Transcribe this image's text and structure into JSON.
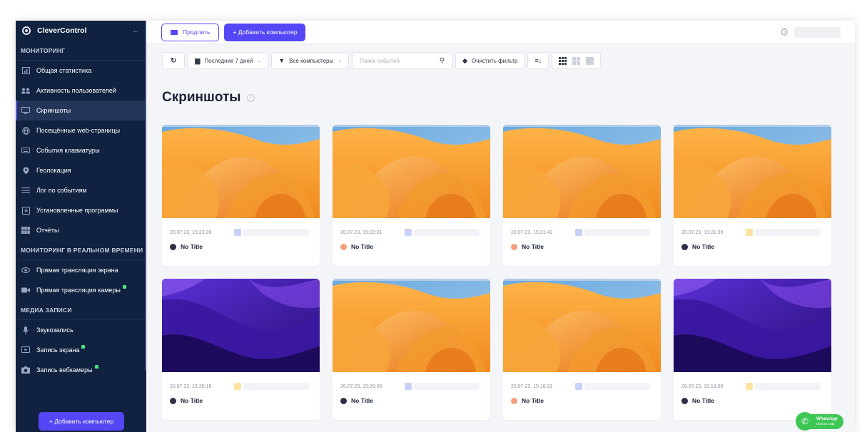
{
  "sidebar": {
    "brand": "CleverControl",
    "section_monitoring": "МОНИТОРИНГ",
    "monitoring_items": [
      {
        "label": "Общая статистика",
        "icon": "stats-icon"
      },
      {
        "label": "Активность пользователей",
        "icon": "users-icon"
      },
      {
        "label": "Скриншоты",
        "icon": "monitor-icon"
      },
      {
        "label": "Посещённые web-страницы",
        "icon": "globe-icon"
      },
      {
        "label": "События клавиатуры",
        "icon": "keyboard-icon"
      },
      {
        "label": "Геолокация",
        "icon": "pin-icon"
      },
      {
        "label": "Лог по событиям",
        "icon": "list-icon"
      },
      {
        "label": "Установленные программы",
        "icon": "install-icon"
      },
      {
        "label": "Отчёты",
        "icon": "reports-icon"
      }
    ],
    "section_realtime": "МОНИТОРИНГ В РЕАЛЬНОМ ВРЕМЕНИ",
    "realtime_items": [
      {
        "label": "Прямая трансляция экрана",
        "icon": "eye-icon"
      },
      {
        "label": "Прямая трансляция камеры",
        "icon": "camera-icon"
      }
    ],
    "section_media": "МЕДИА ЗАПИСИ",
    "media_items": [
      {
        "label": "Звукозапись",
        "icon": "microphone-icon"
      },
      {
        "label": "Запись экрана",
        "icon": "screen-record-icon"
      },
      {
        "label": "Запись вебкамеры",
        "icon": "webcam-icon"
      }
    ],
    "add_button": "+ Добавить компьютер"
  },
  "topbar": {
    "extend_label": "Продлить",
    "add_computer_label": "+ Добавить компьютер"
  },
  "filters": {
    "period": "Последние 7 дней",
    "computers": "Все компьютеры",
    "search_placeholder": "Поиск событий",
    "clear": "Очистить фильтр"
  },
  "page": {
    "title": "Скриншоты"
  },
  "screenshots": [
    {
      "date": "20.07.23, 15:23:26",
      "title": "No Title",
      "dot": "#2c3047",
      "tag": "#c9d1fb",
      "wallpaper": "orange"
    },
    {
      "date": "20.07.23, 15:22:01",
      "title": "No Title",
      "dot": "#f5a07c",
      "tag": "#c9d1fb",
      "wallpaper": "orange"
    },
    {
      "date": "20.07.23, 15:21:42",
      "title": "No Title",
      "dot": "#f5a07c",
      "tag": "#c9d1fb",
      "wallpaper": "orange"
    },
    {
      "date": "20.07.23, 15:21:35",
      "title": "No Title",
      "dot": "#2c3047",
      "tag": "#fde3a0",
      "wallpaper": "orange"
    },
    {
      "date": "20.07.23, 15:20:16",
      "title": "No Title",
      "dot": "#2c3047",
      "tag": "#fde3a0",
      "wallpaper": "purple"
    },
    {
      "date": "20.07.23, 15:20:00",
      "title": "No Title",
      "dot": "#2c3047",
      "tag": "#c9d1fb",
      "wallpaper": "orange"
    },
    {
      "date": "20.07.23, 15:18:31",
      "title": "No Title",
      "dot": "#f5a07c",
      "tag": "#c9d1fb",
      "wallpaper": "orange"
    },
    {
      "date": "20.07.23, 15:18:09",
      "title": "No Title",
      "dot": "#2c3047",
      "tag": "#fde3a0",
      "wallpaper": "purple"
    }
  ],
  "whatsapp": {
    "label": "WhatsApp",
    "sub": "Click to Chat"
  },
  "colors": {
    "accent": "#5547f5",
    "sidebar": "#112240"
  }
}
